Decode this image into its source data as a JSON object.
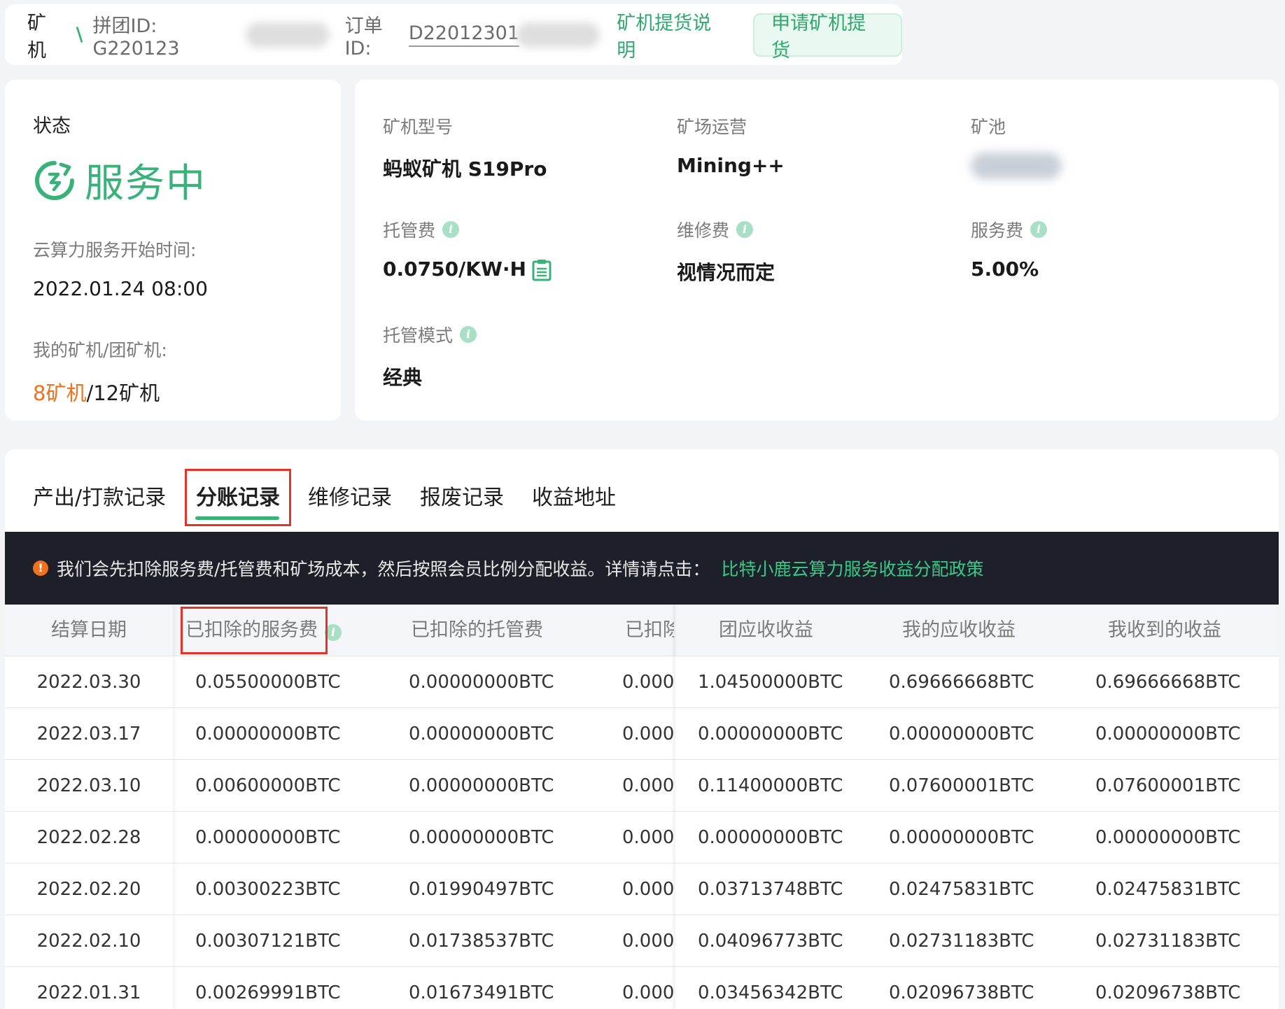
{
  "topbar": {
    "crumb": "矿机",
    "separator": "\\",
    "group_id_label": "拼团ID: G220123",
    "order_id_label": "订单ID: ",
    "order_id_value": "D22012301",
    "pickup_info_link": "矿机提货说明",
    "apply_pickup_button": "申请矿机提货"
  },
  "status": {
    "label": "状态",
    "state": "服务中",
    "start_label": "云算力服务开始时间:",
    "start_value": "2022.01.24 08:00",
    "machines_label": "我的矿机/团矿机:",
    "my_machines": "8矿机",
    "machines_sep": "/",
    "group_machines": "12矿机"
  },
  "info": {
    "model_label": "矿机型号",
    "model_value": "蚂蚁矿机 S19Pro",
    "operator_label": "矿场运营",
    "operator_value": "Mining++",
    "pool_label": "矿池",
    "hosting_fee_label": "托管费",
    "hosting_fee_value": "0.0750/KW·H",
    "repair_fee_label": "维修费",
    "repair_fee_value": "视情况而定",
    "service_fee_label": "服务费",
    "service_fee_value": "5.00%",
    "hosting_mode_label": "托管模式",
    "hosting_mode_value": "经典"
  },
  "tabs": [
    "产出/打款记录",
    "分账记录",
    "维修记录",
    "报废记录",
    "收益地址"
  ],
  "active_tab_index": 1,
  "notice": {
    "text": "我们会先扣除服务费/托管费和矿场成本，然后按照会员比例分配收益。详情请点击：",
    "link": "比特小鹿云算力服务收益分配政策"
  },
  "table": {
    "headers": [
      "结算日期",
      "已扣除的服务费",
      "已扣除的托管费",
      "已扣除",
      "团应收收益",
      "我的应收收益",
      "我收到的收益"
    ],
    "rows": [
      [
        "2022.03.30",
        "0.05500000BTC",
        "0.00000000BTC",
        "0.000",
        "1.04500000BTC",
        "0.69666668BTC",
        "0.69666668BTC"
      ],
      [
        "2022.03.17",
        "0.00000000BTC",
        "0.00000000BTC",
        "0.000",
        "0.00000000BTC",
        "0.00000000BTC",
        "0.00000000BTC"
      ],
      [
        "2022.03.10",
        "0.00600000BTC",
        "0.00000000BTC",
        "0.000",
        "0.11400000BTC",
        "0.07600001BTC",
        "0.07600001BTC"
      ],
      [
        "2022.02.28",
        "0.00000000BTC",
        "0.00000000BTC",
        "0.000",
        "0.00000000BTC",
        "0.00000000BTC",
        "0.00000000BTC"
      ],
      [
        "2022.02.20",
        "0.00300223BTC",
        "0.01990497BTC",
        "0.000",
        "0.03713748BTC",
        "0.02475831BTC",
        "0.02475831BTC"
      ],
      [
        "2022.02.10",
        "0.00307121BTC",
        "0.01738537BTC",
        "0.000",
        "0.04096773BTC",
        "0.02731183BTC",
        "0.02731183BTC"
      ],
      [
        "2022.01.31",
        "0.00269991BTC",
        "0.01673491BTC",
        "0.000",
        "0.03456342BTC",
        "0.02096738BTC",
        "0.02096738BTC"
      ]
    ]
  },
  "colors": {
    "accent_green": "#39b27a",
    "orange": "#f2711c",
    "highlight_red": "#e5332a",
    "notice_bg": "#1d2029"
  }
}
